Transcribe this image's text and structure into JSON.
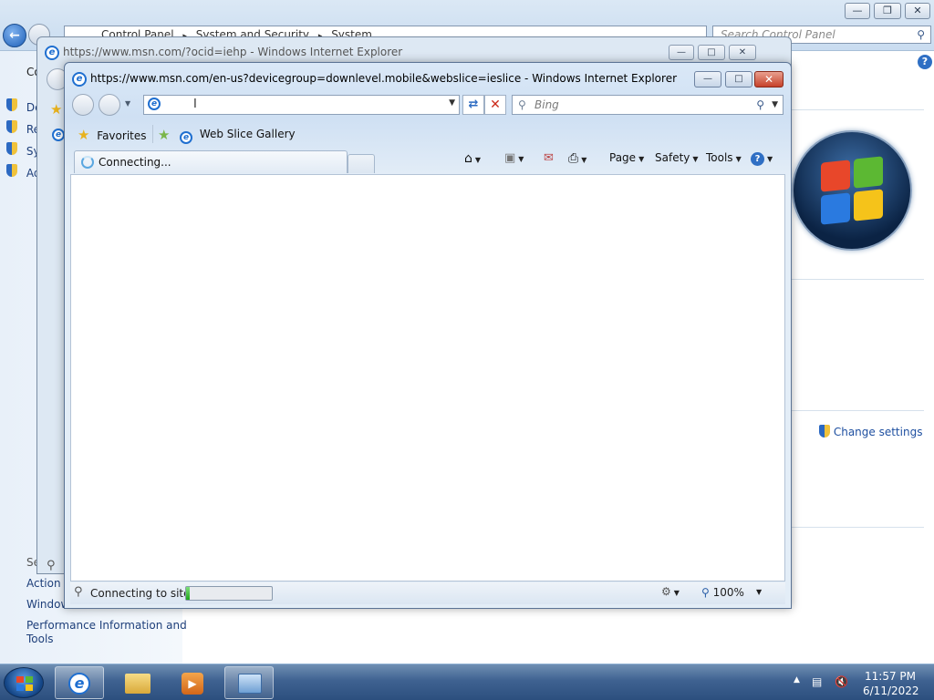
{
  "control_panel": {
    "breadcrumb": [
      "Control Panel",
      "System and Security",
      "System"
    ],
    "search_placeholder": "Search Control Panel",
    "sidebar_heading": "Co",
    "sidebar_links": [
      "De",
      "Re",
      "Sy",
      "Ad"
    ],
    "see_also_heading": "Se",
    "see_also_links": [
      "Action",
      "Window",
      "Performance Information and",
      "Tools"
    ],
    "change_settings": "Change settings"
  },
  "ie_back": {
    "title": "https://www.msn.com/?ocid=iehp - Windows Internet Explorer"
  },
  "ie_front": {
    "title": "https://www.msn.com/en-us?devicegroup=downlevel.mobile&webslice=ieslice - Windows Internet Explorer",
    "address_value": "",
    "search_placeholder": "Bing",
    "favorites_label": "Favorites",
    "web_slice_gallery": "Web Slice Gallery",
    "tab_title": "Connecting...",
    "commands": {
      "page": "Page",
      "safety": "Safety",
      "tools": "Tools"
    },
    "status_text": "Connecting to site :",
    "progress": 0.04,
    "zoom": "100%"
  },
  "taskbar": {
    "time": "11:57 PM",
    "date": "6/11/2022"
  },
  "colors": {
    "ie_blue": "#1f6fd0",
    "close_red": "#c6412a",
    "taskbar": "#3f6291",
    "link_blue": "#1e4fa0"
  }
}
